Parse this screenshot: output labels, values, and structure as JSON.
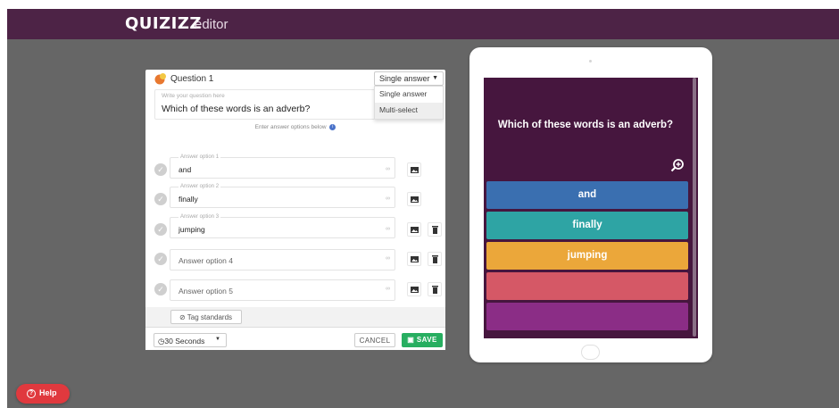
{
  "header": {
    "logo_text": "QUIZIZZ",
    "logo_sub": "editor"
  },
  "editor": {
    "question_label": "Question 1",
    "type_select": {
      "value": "Single answer",
      "options": [
        "Single answer",
        "Multi-select"
      ]
    },
    "question_placeholder": "Write your question here",
    "question_text": "Which of these words is an adverb?",
    "answers_hint": "Enter answer options below",
    "answers": [
      {
        "label": "Answer option 1",
        "value": "and"
      },
      {
        "label": "Answer option 2",
        "value": "finally"
      },
      {
        "label": "Answer option 3",
        "value": "jumping"
      },
      {
        "label": "",
        "value": "",
        "placeholder": "Answer option 4"
      },
      {
        "label": "",
        "value": "",
        "placeholder": "Answer option 5"
      }
    ],
    "tag_label": "Tag standards",
    "timer_value": "30 Seconds",
    "cancel_label": "CANCEL",
    "save_label": "SAVE"
  },
  "preview": {
    "question": "Which of these words is an adverb?",
    "options": [
      {
        "text": "and",
        "color": "#3a6fb0"
      },
      {
        "text": "finally",
        "color": "#2ea4a4"
      },
      {
        "text": "jumping",
        "color": "#eba73a"
      },
      {
        "text": "",
        "color": "#d55866"
      },
      {
        "text": "",
        "color": "#8b2d86"
      }
    ]
  },
  "help": {
    "label": "Help"
  },
  "colors": {
    "brand": "#4d2346",
    "save": "#27ae60",
    "help": "#e0393e"
  }
}
